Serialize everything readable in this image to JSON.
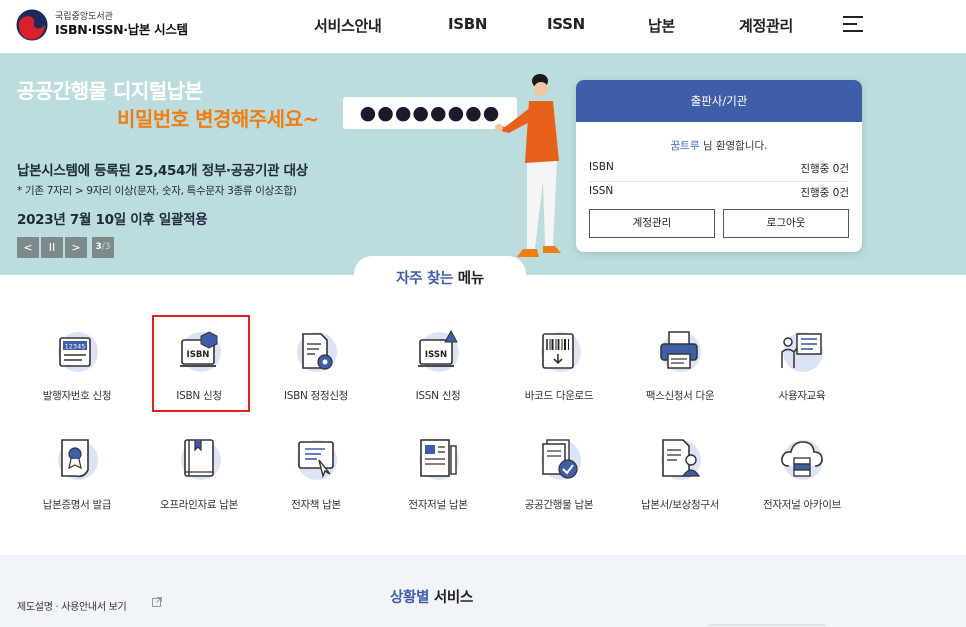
{
  "header": {
    "logo_small": "국립중앙도서관",
    "logo_big": "ISBN·ISSN·납본 시스템",
    "nav": [
      "서비스안내",
      "ISBN",
      "ISSN",
      "납본",
      "계정관리"
    ]
  },
  "banner": {
    "title1": "공공간행물 디지털납본",
    "title2": "비밀번호 변경해주세요~",
    "password_mask": "●●●●●●●●",
    "line1": "납본시스템에 등록된 25,454개 정부·공공기관 대상",
    "line2": "* 기존 7자리 > 9자리 이상(문자, 숫자, 특수문자 3종류 이상조합)",
    "line3": "2023년 7월 10일 이후 일괄적용",
    "controls": {
      "prev": "<",
      "pause": "II",
      "next": ">"
    },
    "slide_current": "3",
    "slide_total": "/3"
  },
  "card": {
    "header": "출판사/기관",
    "username": "꿈트루",
    "welcome_suffix": " 님 환영합니다.",
    "rows": [
      {
        "label": "ISBN",
        "status": "진행중 0건"
      },
      {
        "label": "ISSN",
        "status": "진행중 0건"
      }
    ],
    "account_button": "계정관리",
    "logout_button": "로그아웃"
  },
  "quick_menu": {
    "title_accent": "자주 찾는",
    "title_dark": " 메뉴",
    "items": [
      {
        "label": "발행자번호 신청",
        "icon": "publisher-number-icon",
        "icon_text": "12345"
      },
      {
        "label": "ISBN 신청",
        "icon": "isbn-apply-icon",
        "icon_text": "ISBN"
      },
      {
        "label": "ISBN 정정신청",
        "icon": "isbn-correction-icon",
        "icon_text": ""
      },
      {
        "label": "ISSN 신청",
        "icon": "issn-apply-icon",
        "icon_text": "ISSN"
      },
      {
        "label": "바코드 다운로드",
        "icon": "barcode-download-icon",
        "icon_text": ""
      },
      {
        "label": "팩스신청서 다운",
        "icon": "fax-form-icon",
        "icon_text": ""
      },
      {
        "label": "사용자교육",
        "icon": "user-education-icon",
        "icon_text": ""
      },
      {
        "label": "납본증명서 발급",
        "icon": "certificate-icon",
        "icon_text": ""
      },
      {
        "label": "오프라인자료 납본",
        "icon": "offline-book-icon",
        "icon_text": ""
      },
      {
        "label": "전자책 납본",
        "icon": "ebook-icon",
        "icon_text": ""
      },
      {
        "label": "전자저널 납본",
        "icon": "ejournal-icon",
        "icon_text": ""
      },
      {
        "label": "공공간행물 납본",
        "icon": "public-publication-icon",
        "icon_text": ""
      },
      {
        "label": "납본서/보상청구서",
        "icon": "claim-form-icon",
        "icon_text": ""
      },
      {
        "label": "전자저널 아카이브",
        "icon": "cloud-archive-icon",
        "icon_text": ""
      }
    ]
  },
  "bottom": {
    "guide_link": "제도설명 · 사용안내서 보기",
    "title_accent": "상황별",
    "title_dark": " 서비스"
  },
  "colors": {
    "brand_blue": "#3f5ea9",
    "banner_bg": "#bcdcdd",
    "accent_orange": "#f07d12",
    "highlight_red": "#e02020",
    "icon_circle": "#dbe3f5"
  }
}
